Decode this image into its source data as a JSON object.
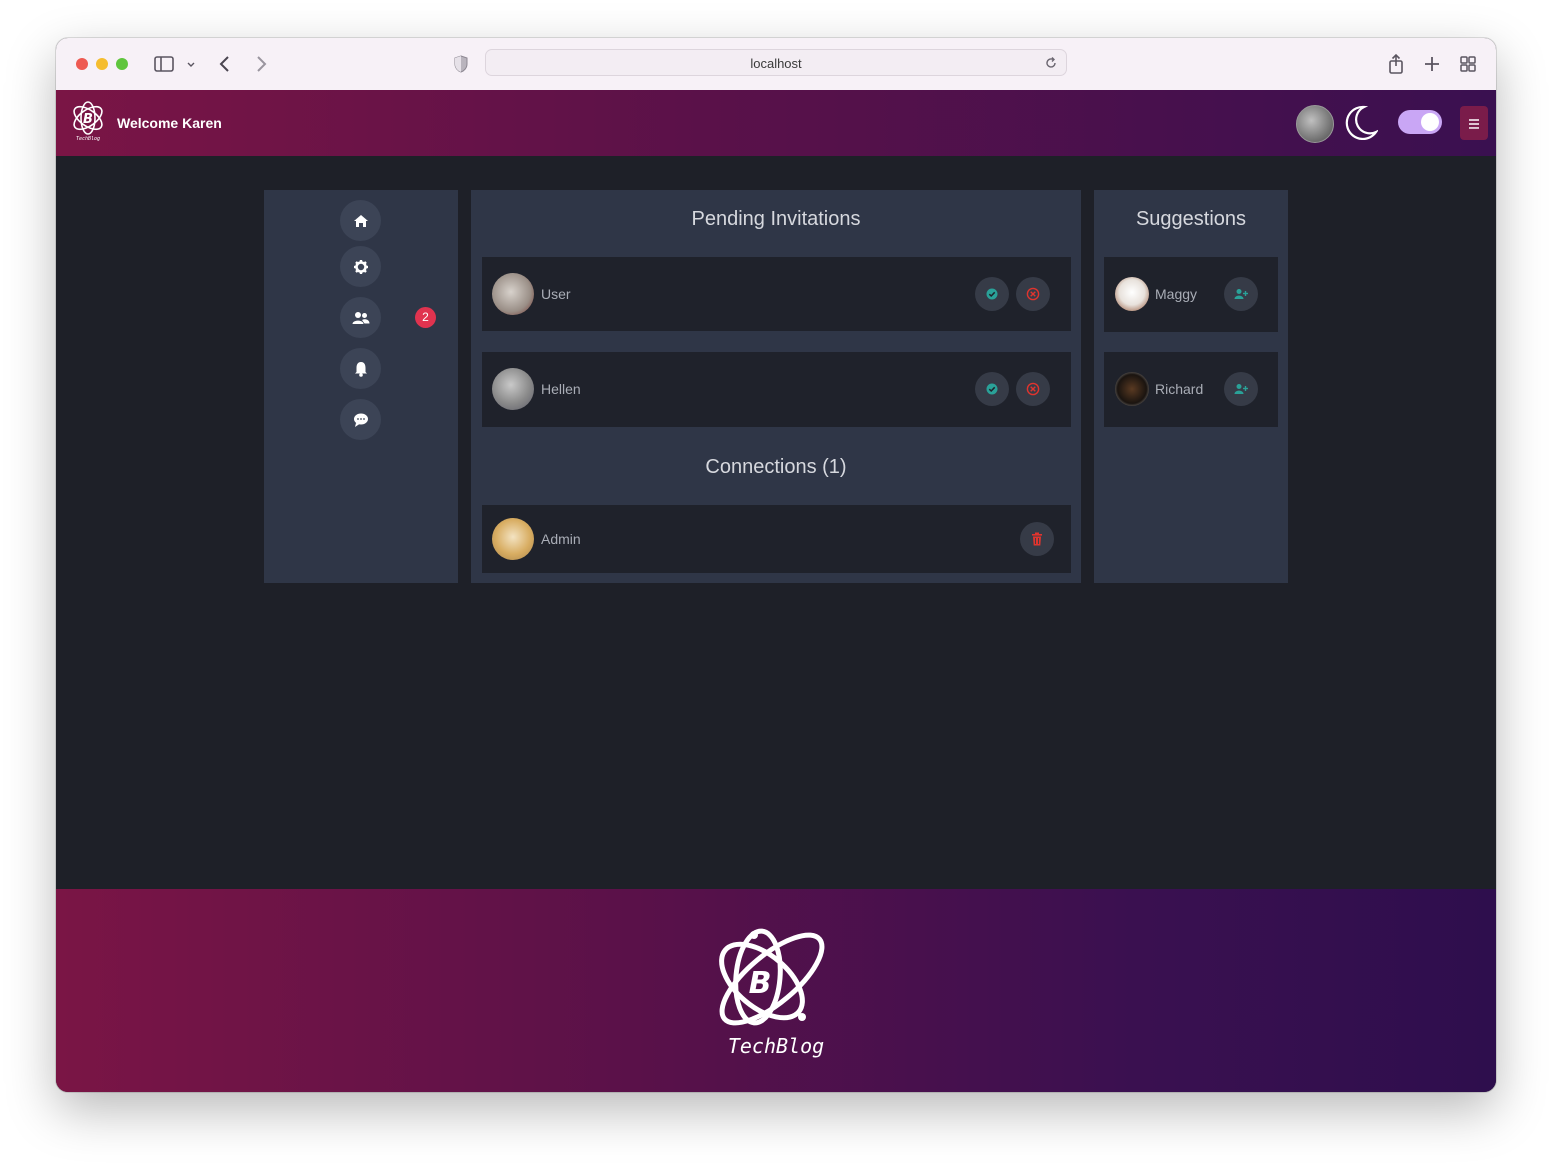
{
  "browser": {
    "url": "localhost",
    "icons": [
      "sidebar-icon",
      "chevron-down-icon",
      "back-icon",
      "forward-icon",
      "shield-icon",
      "reload-icon",
      "share-icon",
      "plus-icon",
      "grid-icon"
    ]
  },
  "header": {
    "welcome": "Welcome Karen",
    "theme_toggle_on": true,
    "colors": {
      "gradient_start": "#7a1545",
      "gradient_end": "#3a1050",
      "toggle": "#c9a6f5"
    }
  },
  "sidebar": {
    "items": [
      {
        "icon": "home-icon"
      },
      {
        "icon": "gear-icon"
      },
      {
        "icon": "users-icon",
        "badge": "2"
      },
      {
        "icon": "bell-icon"
      },
      {
        "icon": "chat-icon"
      }
    ]
  },
  "pending": {
    "title": "Pending Invitations",
    "items": [
      {
        "name": "User"
      },
      {
        "name": "Hellen"
      }
    ]
  },
  "connections": {
    "title": "Connections (1)",
    "items": [
      {
        "name": "Admin"
      }
    ]
  },
  "suggestions": {
    "title": "Suggestions",
    "items": [
      {
        "name": "Maggy"
      },
      {
        "name": "Richard"
      }
    ]
  },
  "footer": {
    "brand": "TechBlog",
    "logo_letter": "B"
  },
  "colors": {
    "accept": "#2aa198",
    "decline": "#e0342e",
    "badge": "#e0334f"
  }
}
